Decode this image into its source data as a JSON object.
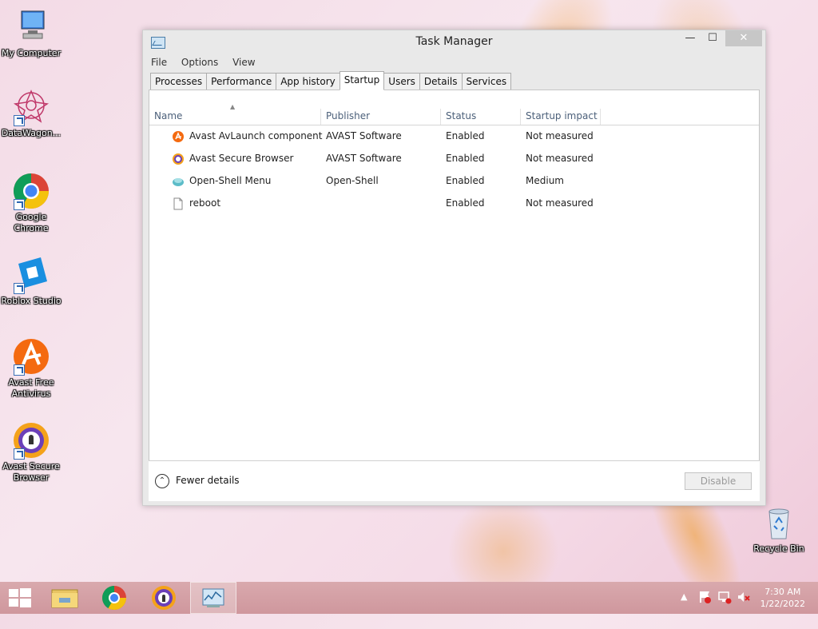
{
  "desktop": {
    "icons": [
      {
        "label": "My Computer"
      },
      {
        "label": "DataWagon..."
      },
      {
        "label": "Google Chrome"
      },
      {
        "label": "Roblox Studio"
      },
      {
        "label": "Avast Free Antivirus"
      },
      {
        "label": "Avast Secure Browser"
      },
      {
        "label": "Recycle Bin"
      }
    ]
  },
  "window": {
    "title": "Task Manager",
    "controls": {
      "minimize": "—",
      "maximize": "☐",
      "close": "✕"
    },
    "menu": [
      "File",
      "Options",
      "View"
    ],
    "tabs": [
      "Processes",
      "Performance",
      "App history",
      "Startup",
      "Users",
      "Details",
      "Services"
    ],
    "active_tab": "Startup",
    "columns": [
      "Name",
      "Publisher",
      "Status",
      "Startup impact"
    ],
    "rows": [
      {
        "name": "Avast AvLaunch component",
        "publisher": "AVAST Software",
        "status": "Enabled",
        "impact": "Not measured",
        "icon": "avast-icon"
      },
      {
        "name": "Avast Secure Browser",
        "publisher": "AVAST Software",
        "status": "Enabled",
        "impact": "Not measured",
        "icon": "avast-browser-icon"
      },
      {
        "name": "Open-Shell Menu",
        "publisher": "Open-Shell",
        "status": "Enabled",
        "impact": "Medium",
        "icon": "open-shell-icon"
      },
      {
        "name": "reboot",
        "publisher": "",
        "status": "Enabled",
        "impact": "Not measured",
        "icon": "file-icon"
      }
    ],
    "footer": {
      "fewer_details": "Fewer details",
      "disable_button": "Disable"
    }
  },
  "taskbar": {
    "clock_time": "7:30 AM",
    "clock_date": "1/22/2022"
  }
}
